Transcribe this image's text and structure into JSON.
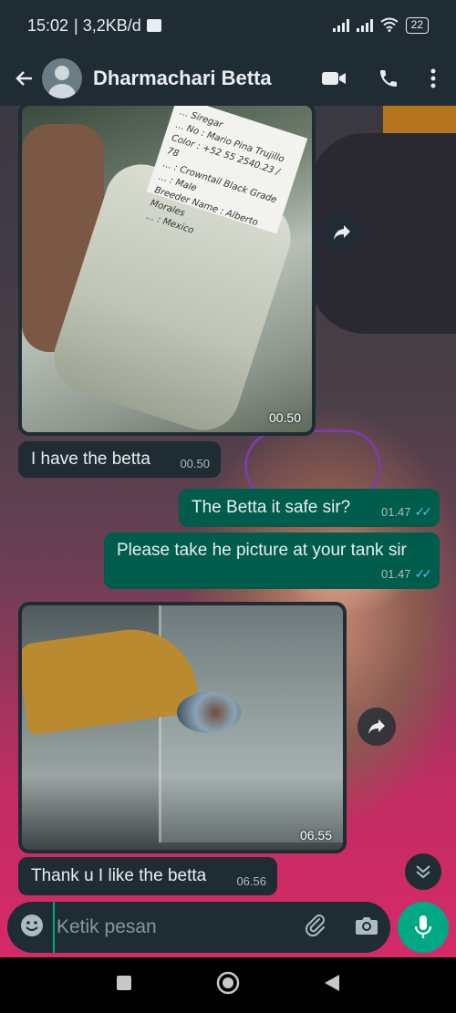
{
  "status_bar": {
    "time": "15:02",
    "data_rate": "| 3,2KB/d",
    "battery": "22"
  },
  "header": {
    "contact_name": "Dharmachari Betta",
    "icons": [
      "back-arrow-icon",
      "avatar",
      "video-call-icon",
      "voice-call-icon",
      "more-vertical-icon"
    ]
  },
  "messages": [
    {
      "type": "image",
      "direction": "incoming",
      "time": "00.50",
      "label_text": [
        "... Siregar",
        "... No : Mario Pina Trujillo",
        "Color : +52 55 2540.23 / 78",
        "... : Crowntail Black Grade",
        "... : Male",
        "Breeder Name : Alberto Morales",
        "... : Mexico"
      ]
    },
    {
      "type": "text",
      "direction": "incoming",
      "text": "I have the betta",
      "time": "00.50"
    },
    {
      "type": "text",
      "direction": "outgoing",
      "text": "The Betta it safe sir?",
      "time": "01.47",
      "status": "read"
    },
    {
      "type": "text",
      "direction": "outgoing",
      "text": "Please take he picture at your tank sir",
      "time": "01.47",
      "status": "read"
    },
    {
      "type": "image",
      "direction": "incoming",
      "time": "06.55"
    },
    {
      "type": "text",
      "direction": "incoming",
      "text": "Thank u I like the betta",
      "time": "06.56"
    }
  ],
  "composer": {
    "placeholder": "Ketik pesan",
    "value": ""
  },
  "colors": {
    "incoming_bubble": "#1f2c34",
    "outgoing_bubble": "#005c4b",
    "accent": "#00a884",
    "read_ticks": "#53bdeb"
  }
}
